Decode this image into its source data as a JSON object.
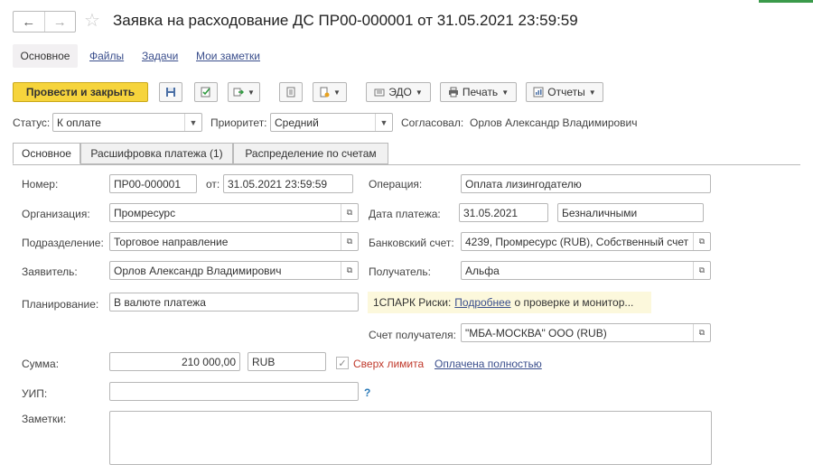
{
  "window": {
    "title": "Заявка на расходование ДС ПР00-000001 от 31.05.2021 23:59:59"
  },
  "sections": {
    "main": "Основное",
    "files": "Файлы",
    "tasks": "Задачи",
    "notes": "Мои заметки"
  },
  "toolbar": {
    "post_close": "Провести и закрыть",
    "edo": "ЭДО",
    "print": "Печать",
    "reports": "Отчеты"
  },
  "header": {
    "status_label": "Статус:",
    "status_value": "К оплате",
    "priority_label": "Приоритет:",
    "priority_value": "Средний",
    "approved_label": "Согласовал:",
    "approved_value": "Орлов Александр Владимирович"
  },
  "tabs": [
    "Основное",
    "Расшифровка платежа (1)",
    "Распределение по счетам"
  ],
  "form": {
    "number_label": "Номер:",
    "number": "ПР00-000001",
    "from_label": "от:",
    "date": "31.05.2021 23:59:59",
    "org_label": "Организация:",
    "org": "Промресурс",
    "dept_label": "Подразделение:",
    "dept": "Торговое направление",
    "applicant_label": "Заявитель:",
    "applicant": "Орлов Александр Владимирович",
    "planning_label": "Планирование:",
    "planning": "В валюте платежа",
    "operation_label": "Операция:",
    "operation": "Оплата лизингодателю",
    "paydate_label": "Дата платежа:",
    "paydate": "31.05.2021",
    "paytype": "Безналичными",
    "bank_label": "Банковский счет:",
    "bank": "4239, Промресурс (RUB), Собственный счет",
    "recipient_label": "Получатель:",
    "recipient": "Альфа",
    "spark_label": "1СПАРК Риски:",
    "spark_link": "Подробнее",
    "spark_rest": "о проверке и монитор...",
    "recipient_acc_label": "Счет получателя:",
    "recipient_acc": "\"МБА-МОСКВА\" ООО (RUB)",
    "sum_label": "Сумма:",
    "sum": "210 000,00",
    "currency": "RUB",
    "over_limit": "Сверх лимита",
    "paid_full": "Оплачена полностью",
    "uip_label": "УИП:",
    "uip_help": "?",
    "notes_label": "Заметки:"
  },
  "colors": {
    "accent": "#f6d43c",
    "link": "#3a4e8c",
    "warning": "#c0392b",
    "help": "#2a7ab8"
  }
}
